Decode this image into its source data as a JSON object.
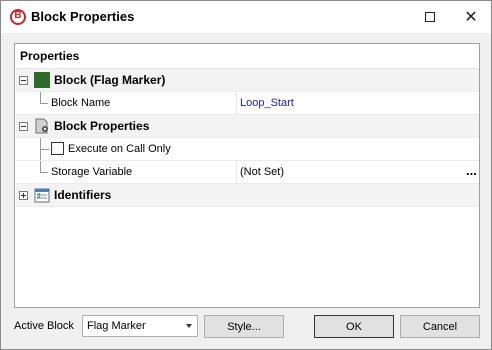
{
  "window": {
    "title": "Block Properties",
    "app_icon": "app-logo-icon",
    "icon_glyph": "B"
  },
  "panel": {
    "header": "Properties",
    "categories": [
      {
        "label": "Block (Flag Marker)",
        "icon": "green-block-icon",
        "expanded": true,
        "props": [
          {
            "label": "Block Name",
            "value": "Loop_Start"
          }
        ]
      },
      {
        "label": "Block Properties",
        "icon": "block-settings-icon",
        "expanded": true,
        "props": [
          {
            "label": "Execute on Call Only",
            "checked": false
          },
          {
            "label": "Storage Variable",
            "value": "(Not Set)",
            "action": "..."
          }
        ]
      },
      {
        "label": "Identifiers",
        "icon": "calendar-icon",
        "expanded": false
      }
    ]
  },
  "footer": {
    "active_block_label": "Active Block",
    "active_block_value": "Flag Marker",
    "style_button": "Style...",
    "ok_button": "OK",
    "cancel_button": "Cancel"
  },
  "colors": {
    "link": "#1a1ab8",
    "block_green": "#2e6b2a",
    "logo_red": "#c62828"
  }
}
